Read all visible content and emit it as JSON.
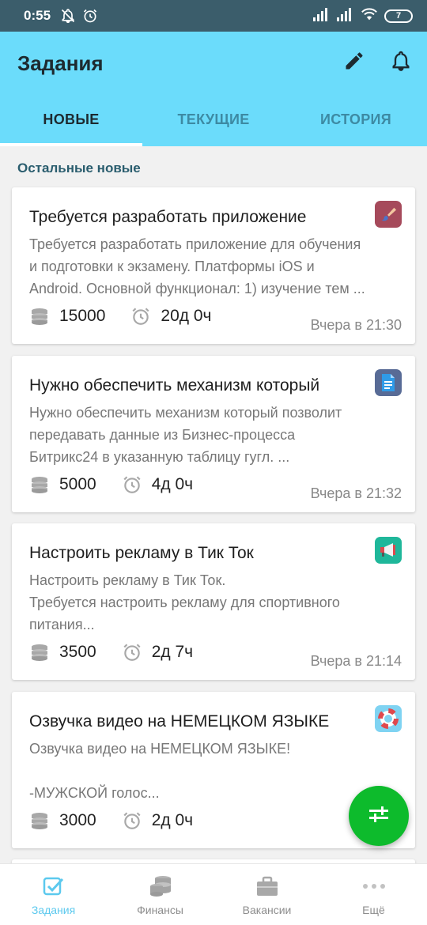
{
  "status_bar": {
    "time": "0:55",
    "battery": "7"
  },
  "app_bar": {
    "title": "Задания",
    "tabs": [
      {
        "label": "НОВЫЕ",
        "active": true
      },
      {
        "label": "ТЕКУЩИЕ",
        "active": false
      },
      {
        "label": "ИСТОРИЯ",
        "active": false
      }
    ]
  },
  "section_title": "Остальные новые",
  "tasks": [
    {
      "title": "Требуется разработать приложение",
      "desc": [
        "Требуется разработать приложение для обучения",
        "и подготовки к экзамену. Платформы iOS и",
        "Android. Основной функционал: 1) изучение тем ..."
      ],
      "price": "15000",
      "duration": "20д 0ч",
      "date": "Вчера в 21:30",
      "icon": "paintbrush-icon",
      "icon_bg": "#a64a5b"
    },
    {
      "title": "Нужно обеспечить механизм который",
      "desc": [
        "Нужно обеспечить механизм который позволит",
        "передавать данные из Бизнес-процесса",
        "Битрикс24 в указанную таблицу гугл. ..."
      ],
      "price": "5000",
      "duration": "4д 0ч",
      "date": "Вчера в 21:32",
      "icon": "document-icon",
      "icon_bg": "#586b96"
    },
    {
      "title": "Настроить рекламу в Тик Ток",
      "desc": [
        "Настроить рекламу в Тик Ток.",
        "Требуется настроить рекламу для спортивного",
        "питания..."
      ],
      "price": "3500",
      "duration": "2д 7ч",
      "date": "Вчера в 21:14",
      "icon": "megaphone-icon",
      "icon_bg": "#1fb79a"
    },
    {
      "title": "Озвучка видео на НЕМЕЦКОМ ЯЗЫКЕ",
      "desc": [
        "Озвучка видео на НЕМЕЦКОМ ЯЗЫКЕ!",
        "",
        "-МУЖСКОЙ голос..."
      ],
      "price": "3000",
      "duration": "2д 0ч",
      "date": "",
      "icon": "lifebuoy-icon",
      "icon_bg": "#7fd3f2"
    }
  ],
  "bottom_nav": [
    {
      "label": "Задания",
      "icon": "tasks-check-icon",
      "active": true
    },
    {
      "label": "Финансы",
      "icon": "coins-icon",
      "active": false
    },
    {
      "label": "Вакансии",
      "icon": "briefcase-icon",
      "active": false
    },
    {
      "label": "Ещё",
      "icon": "more-dots-icon",
      "active": false
    }
  ],
  "colors": {
    "accent": "#6bdcfb",
    "status_bar": "#3b5d6b",
    "fab": "#0dbb2c",
    "nav_active": "#5cc9ee"
  }
}
